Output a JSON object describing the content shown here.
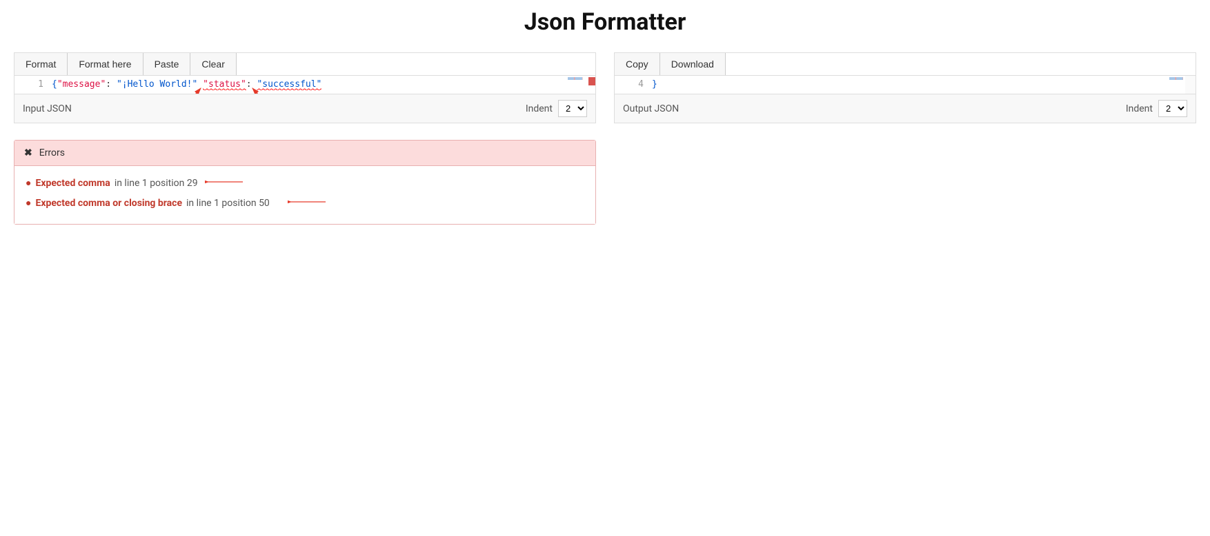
{
  "title": "Json Formatter",
  "toolbar_left": {
    "format": "Format",
    "format_here": "Format here",
    "paste": "Paste",
    "clear": "Clear"
  },
  "toolbar_right": {
    "copy": "Copy",
    "download": "Download"
  },
  "input": {
    "label": "Input JSON",
    "line_number": "1",
    "indent_label": "Indent",
    "indent_value": "2",
    "code": {
      "open_brace": "{",
      "key1": "\"message\"",
      "colon1": ": ",
      "val1": "\"¡Hello World!\"",
      "space1": " ",
      "key2": "\"status\"",
      "colon2": ": ",
      "val2": "\"successful\"",
      "close_brace": ""
    }
  },
  "output": {
    "label": "Output JSON",
    "line_number": "4",
    "indent_label": "Indent",
    "indent_value": "2",
    "code": {
      "close_brace": "}"
    }
  },
  "errors": {
    "header": "Errors",
    "items": [
      {
        "msg": "Expected comma",
        "loc": "in line 1 position 29"
      },
      {
        "msg": "Expected comma or closing brace",
        "loc": "in line 1 position 50"
      }
    ]
  }
}
